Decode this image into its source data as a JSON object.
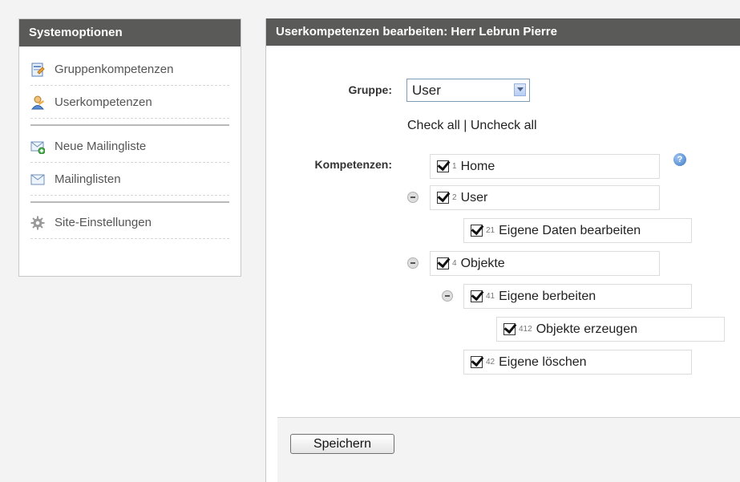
{
  "sidebar": {
    "title": "Systemoptionen",
    "items": [
      {
        "label": "Gruppenkompetenzen",
        "icon": "group-competence-icon"
      },
      {
        "label": "Userkompetenzen",
        "icon": "user-competence-icon"
      },
      {
        "label": "Neue Mailingliste",
        "icon": "new-mail-icon"
      },
      {
        "label": "Mailinglisten",
        "icon": "mail-icon"
      },
      {
        "label": "Site-Einstellungen",
        "icon": "gear-icon"
      }
    ]
  },
  "main": {
    "title": "Userkompetenzen bearbeiten:  Herr Lebrun Pierre",
    "group_label": "Gruppe:",
    "group_value": "User",
    "check_all": "Check all",
    "divider": "|",
    "uncheck_all": "Uncheck all",
    "competences_label": "Kompetenzen:",
    "tree": [
      {
        "num": "1",
        "label": "Home",
        "checked": true
      },
      {
        "num": "2",
        "label": "User",
        "checked": true
      },
      {
        "num": "21",
        "label": "Eigene Daten bearbeiten",
        "checked": true
      },
      {
        "num": "4",
        "label": "Objekte",
        "checked": true
      },
      {
        "num": "41",
        "label": "Eigene berbeiten",
        "checked": true
      },
      {
        "num": "412",
        "label": "Objekte erzeugen",
        "checked": true
      },
      {
        "num": "42",
        "label": "Eigene löschen",
        "checked": true
      }
    ],
    "save_label": "Speichern"
  },
  "colors": {
    "header_bg": "#5a5a58",
    "header_text": "#ffffff",
    "page_bg": "#f3f3f3"
  }
}
